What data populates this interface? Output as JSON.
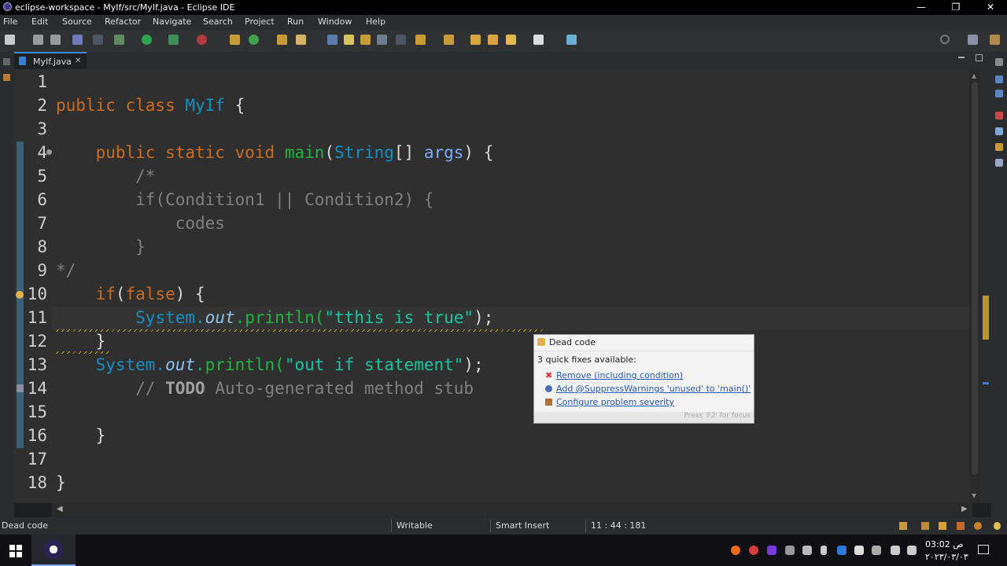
{
  "window": {
    "title": "eclipse-workspace - MyIf/src/MyIf.java - Eclipse IDE",
    "controls": [
      "—",
      "❐",
      "✕"
    ]
  },
  "menu": [
    "File",
    "Edit",
    "Source",
    "Refactor",
    "Navigate",
    "Search",
    "Project",
    "Run",
    "Window",
    "Help"
  ],
  "editor": {
    "tab_label": "MyIf.java",
    "tab_close": "✕",
    "line_numbers": [
      "1",
      "2",
      "3",
      "4",
      "5",
      "6",
      "7",
      "8",
      "9",
      "10",
      "11",
      "12",
      "13",
      "14",
      "15",
      "16",
      "17",
      "18"
    ],
    "lines": {
      "l2_kw": "public class",
      "l2_name": "MyIf",
      "l2_rest": " {",
      "l4_kw": "public static void",
      "l4_fn": "main",
      "l4_type": "String",
      "l4_param": "args",
      "l5": "/*",
      "l6": "if(Condition1 || Condition2) {",
      "l7": "codes",
      "l8": "}",
      "l9": "*/",
      "l10_kw": "if",
      "l10_false": "false",
      "l11_sys": "System.",
      "l11_out": "out",
      "l11_fn": ".println(",
      "l11_str": "\"tthis is true\"",
      "l11_end": ");",
      "l12": "}",
      "l13_sys": "System.",
      "l13_out": "out",
      "l13_fn": ".println(",
      "l13_str": "\"out if statement\"",
      "l13_end": ");",
      "l14_cm": "// ",
      "l14_todo": "TODO",
      "l14_rest": " Auto-generated method stub",
      "l16": "}",
      "l18": "}"
    }
  },
  "popup": {
    "title": "Dead code",
    "subtitle": "3 quick fixes available:",
    "fixes": [
      "Remove (including condition)",
      "Add @SuppressWarnings 'unused' to 'main()'",
      "Configure problem severity"
    ],
    "footer": "Press 'F2' for focus"
  },
  "status": {
    "message": "Dead code",
    "writable": "Writable",
    "insert_mode": "Smart Insert",
    "position": "11 : 44 : 181"
  },
  "taskbar": {
    "time": "03:02 ص",
    "date": "٢٠٢٣/٠٣/٠٣"
  },
  "colors": {
    "keyword": "#cc6c1d",
    "string": "#17c6a3",
    "type": "#1290c3",
    "method": "#1eb540",
    "comment": "#808080",
    "tab_accent": "#3a8ee6"
  }
}
